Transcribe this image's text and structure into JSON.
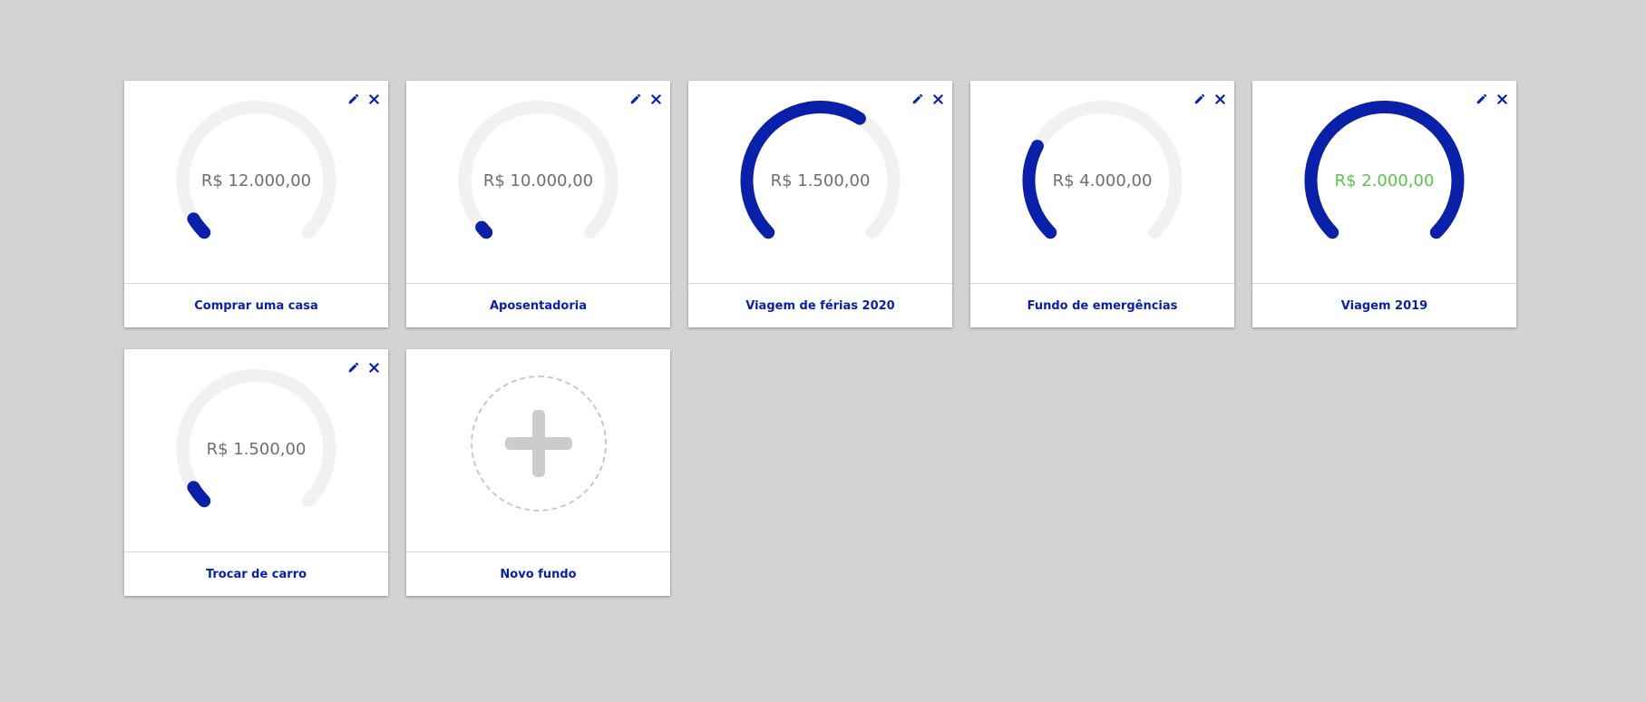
{
  "colors": {
    "accent": "#0b20a8",
    "track": "#f1f1f1",
    "value_text": "#6e6e6e",
    "complete_text": "#5cc24a",
    "background": "#d3d3d3"
  },
  "funds": [
    {
      "name": "Comprar uma casa",
      "amount": "R$ 12.000,00",
      "progress": 0.05,
      "complete": false
    },
    {
      "name": "Aposentadoria",
      "amount": "R$ 10.000,00",
      "progress": 0.02,
      "complete": false
    },
    {
      "name": "Viagem de férias 2020",
      "amount": "R$ 1.500,00",
      "progress": 0.62,
      "complete": false
    },
    {
      "name": "Fundo de emergências",
      "amount": "R$ 4.000,00",
      "progress": 0.27,
      "complete": false
    },
    {
      "name": "Viagem 2019",
      "amount": "R$ 2.000,00",
      "progress": 1.0,
      "complete": true
    },
    {
      "name": "Trocar de carro",
      "amount": "R$ 1.500,00",
      "progress": 0.05,
      "complete": false
    }
  ],
  "new_fund": {
    "label": "Novo fundo",
    "icon": "plus-icon"
  },
  "icons": {
    "edit": "pencil-icon",
    "delete": "close-icon"
  }
}
